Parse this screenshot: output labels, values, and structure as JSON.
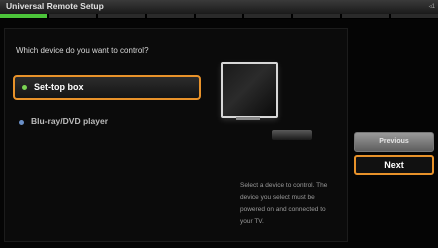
{
  "window": {
    "title": "Universal Remote Setup",
    "corner_label": "◃1"
  },
  "progress": {
    "total_steps": 9,
    "current_step": 1
  },
  "main": {
    "question": "Which device do you want to control?",
    "options": [
      {
        "label": "Set-top box",
        "selected": true
      },
      {
        "label": "Blu-ray/DVD player",
        "selected": false
      }
    ],
    "description": "Select a device to control. The device you select must be powered on and connected to your TV."
  },
  "buttons": {
    "previous_label": "Previous",
    "next_label": "Next"
  },
  "colors": {
    "accent_orange": "#e8922a",
    "progress_green": "#4cc43a",
    "selected_dot": "#7bd453",
    "unselected_dot": "#6a90c8"
  },
  "icons": {
    "tv": "tv-icon",
    "settop": "set-top-box-icon"
  }
}
